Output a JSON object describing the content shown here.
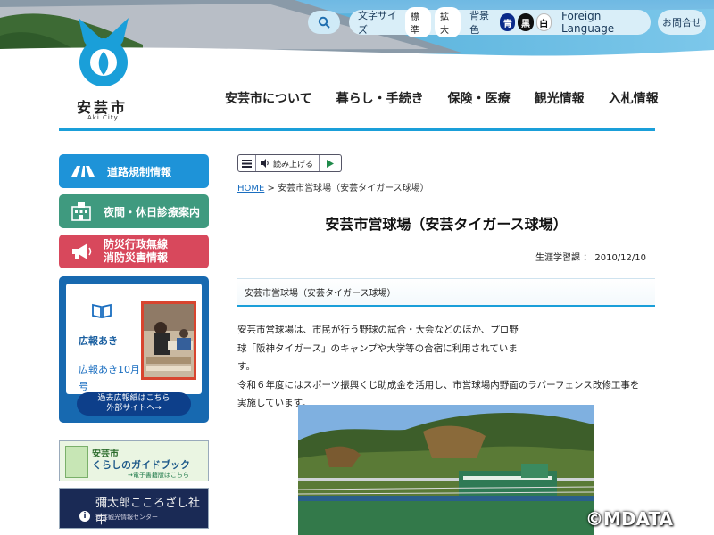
{
  "header": {
    "utility": {
      "text_size_label": "文字サイズ",
      "text_size_normal": "標準",
      "text_size_large": "拡大",
      "bg_color_label": "背景色",
      "bg_blue": "青",
      "bg_black": "黒",
      "bg_white": "白",
      "foreign_language": "Foreign Language"
    },
    "contact": "お問合せ",
    "logo": {
      "name": "安芸市",
      "sub": "Aki City"
    },
    "nav": [
      "安芸市について",
      "暮らし・手続き",
      "保険・医療",
      "観光情報",
      "入札情報"
    ]
  },
  "sidebar": {
    "road_info": "道路規制情報",
    "night_medical": "夜間・休日診療案内",
    "disaster_line1": "防災行政無線",
    "disaster_line2": "消防災害情報",
    "koho": {
      "title": "広報あき",
      "link": "広報あき10月号",
      "archive_line1": "過去広報紙はこちら",
      "archive_line2": "外部サイトへ→"
    },
    "guide": {
      "line1": "安芸市",
      "line2": "くらしのガイドブック",
      "line3": "→電子書籍版はこちら"
    },
    "yataro": {
      "line1": "彌太郎こころざし社中",
      "line2": "安芸観光情報センター"
    }
  },
  "main": {
    "reader": {
      "read_aloud": "読み上げる"
    },
    "breadcrumb": {
      "home": "HOME",
      "current": " > 安芸市営球場（安芸タイガース球場）"
    },
    "title": "安芸市営球場（安芸タイガース球場）",
    "meta": "生涯学習課 ： 2010/12/10",
    "section_heading": "安芸市営球場（安芸タイガース球場）",
    "body": {
      "line1": "安芸市営球場は、市民が行う野球の試合・大会などのほか、プロ野",
      "line2": "球「阪神タイガース」のキャンプや大学等の合宿に利用されていま",
      "line3": "す。",
      "line4": "令和６年度にはスポーツ振興くじ助成金を活用し、市営球場内野面のラバーフェンス改修工事を",
      "line5": "実施しています。"
    },
    "watermark": "©MDATA"
  },
  "colors": {
    "accent": "#1a9fd9",
    "road_btn": "#1e93d8",
    "medical_btn": "#3f9a7f",
    "disaster_btn": "#d8485c",
    "koho_bg": "#1769b0"
  },
  "icons": [
    "search-icon",
    "logo-emblem",
    "road-sign-icon",
    "hospital-icon",
    "megaphone-icon",
    "book-icon",
    "menu-icon",
    "speaker-icon",
    "play-icon",
    "info-icon"
  ]
}
